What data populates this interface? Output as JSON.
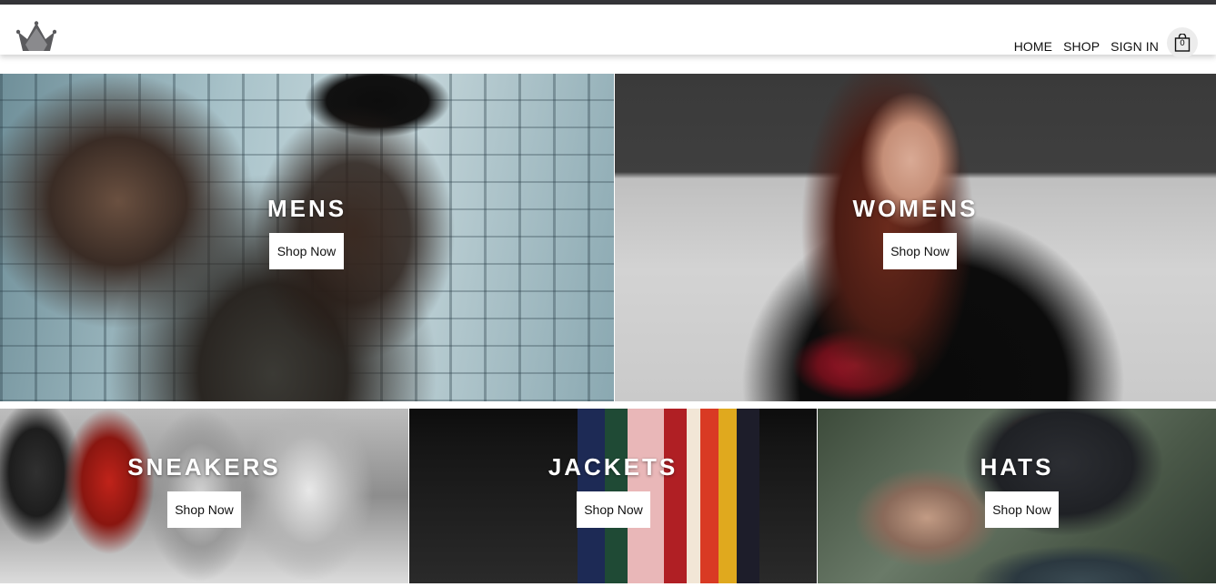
{
  "header": {
    "logo_icon": "crown-icon",
    "nav": [
      "HOME",
      "SHOP",
      "SIGN IN"
    ],
    "cart": {
      "icon": "shopping-bag-icon",
      "count": "0"
    }
  },
  "tiles": [
    {
      "title": "MENS",
      "button": "Shop Now"
    },
    {
      "title": "WOMENS",
      "button": "Shop Now"
    },
    {
      "title": "SNEAKERS",
      "button": "Shop Now"
    },
    {
      "title": "JACKETS",
      "button": "Shop Now"
    },
    {
      "title": "HATS",
      "button": "Shop Now"
    }
  ],
  "colors": {
    "top_bar": "#353538",
    "header_bg": "#ffffff",
    "text": "#111111",
    "tile_text": "#ffffff"
  }
}
